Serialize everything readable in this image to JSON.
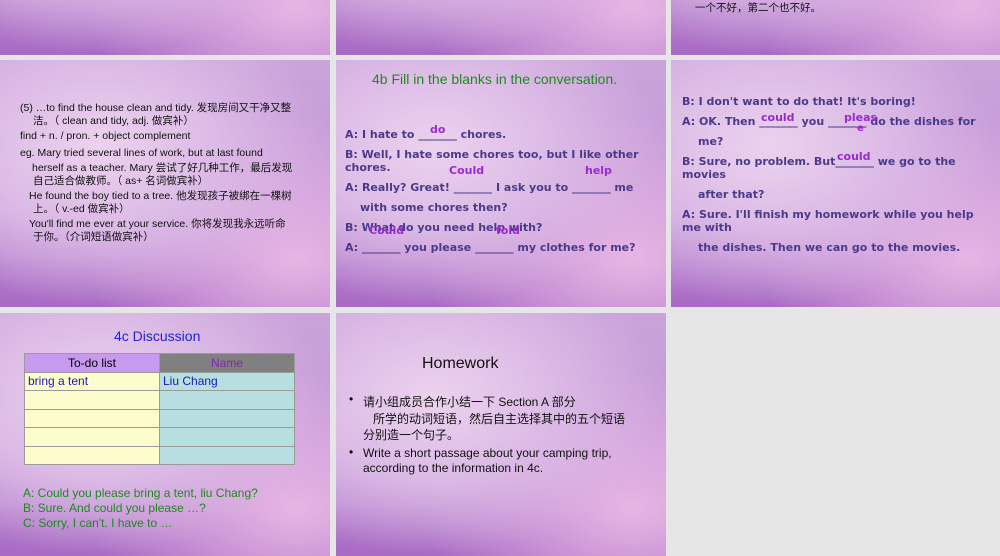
{
  "slide_top_right": {
    "line": "一个不好，第二个也不好。"
  },
  "slide_find": {
    "lines": [
      "(5) …to find the house clean and tidy. 发现房间又干净又整",
      "洁。（ clean and tidy, adj. 做宾补）",
      "find + n. / pron. + object complement",
      "eg. Mary tried several lines of work, but at last found",
      "herself as a teacher. Mary 尝试了好几种工作，最后发现",
      "自己适合做教师。（ as+ 名词做宾补）",
      "He found the boy tied to a tree.  他发现孩子被绑在一棵树",
      "上。（ v.-ed 做宾补）",
      "You'll find me ever at your service.  你将发现我永远听命",
      "于你。（介词短语做宾补）"
    ]
  },
  "slide_4b": {
    "title": "4b Fill in the blanks in the conversation.",
    "lines": [
      "A: I hate to _______ chores.",
      "B: Well, I hate some chores too, but I like other",
      "chores.",
      "A: Really? Great! _______ I ask you to _______ me",
      "with some chores then?",
      "B: What do you need help with?",
      "A: _______ you please _______ my clothes for me?"
    ],
    "answers": [
      "do",
      "Could",
      "help",
      "Could",
      "fold"
    ]
  },
  "slide_4b_cont": {
    "lines": [
      "B: I don't want to do that! It's boring!",
      "A: OK. Then _______ you _______ do the dishes for",
      "me?",
      "B: Sure, no problem. But_______ we go to the",
      "movies",
      "after that?",
      "A: Sure. I'll finish my homework while you help",
      "me with",
      "the dishes. Then we can go to the movies."
    ],
    "answers": [
      "could",
      "pleas",
      "e",
      "could"
    ]
  },
  "slide_4c": {
    "title": "4c Discussion",
    "headers": [
      "To-do list",
      "Name"
    ],
    "rows": [
      [
        "bring a tent",
        "Liu Chang"
      ],
      [
        "",
        ""
      ],
      [
        "",
        ""
      ],
      [
        "",
        ""
      ],
      [
        "",
        ""
      ]
    ],
    "dialog": [
      "A: Could you please bring a tent, liu Chang?",
      "B: Sure. And could you please …?",
      "C: Sorry, I can't. I have to …"
    ]
  },
  "slide_homework": {
    "title": "Homework",
    "bullets": [
      [
        "请小组成员合作小结一下 Section A 部分",
        "  所学的动词短语，然后自主选择其中的五个短语",
        "分别造一个句子。"
      ],
      [
        "Write a short passage about your camping trip,",
        "according to the information in 4c."
      ]
    ]
  }
}
